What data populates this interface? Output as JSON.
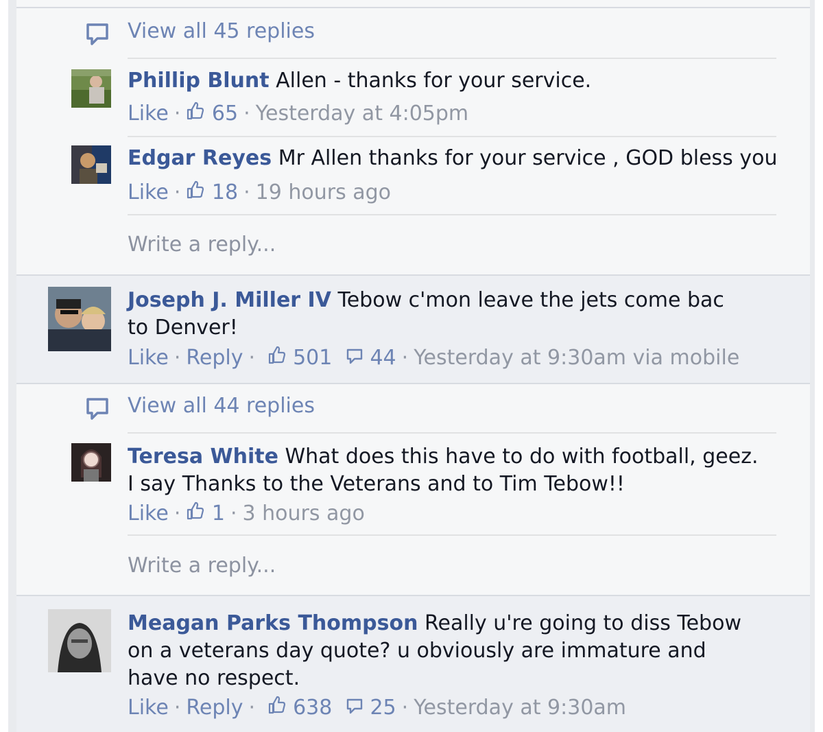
{
  "thread1": {
    "view_all": "View all 45 replies",
    "replies": [
      {
        "author": "Phillip Blunt",
        "text": "Allen - thanks for your service.",
        "like": "Like",
        "likes": "65",
        "time": "Yesterday at 4:05pm"
      },
      {
        "author": "Edgar Reyes",
        "text": "Mr Allen thanks for your service , GOD bless you",
        "like": "Like",
        "likes": "18",
        "time": "19 hours ago"
      }
    ],
    "write_reply": "Write a reply..."
  },
  "comment2": {
    "author": "Joseph J. Miller IV",
    "text": "Tebow c'mon leave the jets come bac to Denver!",
    "like": "Like",
    "reply": "Reply",
    "likes": "501",
    "replies": "44",
    "time": "Yesterday at 9:30am via mobile"
  },
  "thread2": {
    "view_all": "View all 44 replies",
    "replies": [
      {
        "author": "Teresa White",
        "text": "What does this have to do with football, geez. I say Thanks to the Veterans and to Tim Tebow!!",
        "like": "Like",
        "likes": "1",
        "time": "3 hours ago"
      }
    ],
    "write_reply": "Write a reply..."
  },
  "comment3": {
    "author": "Meagan Parks Thompson",
    "text": "Really u're going to diss Tebow on a veterans day quote? u obviously are immature and have no respect.",
    "like": "Like",
    "reply": "Reply",
    "likes": "638",
    "replies": "25",
    "time": "Yesterday at 9:30am"
  },
  "colors": {
    "link": "#3b5998",
    "meta": "#6d84b4",
    "text": "#141823"
  }
}
